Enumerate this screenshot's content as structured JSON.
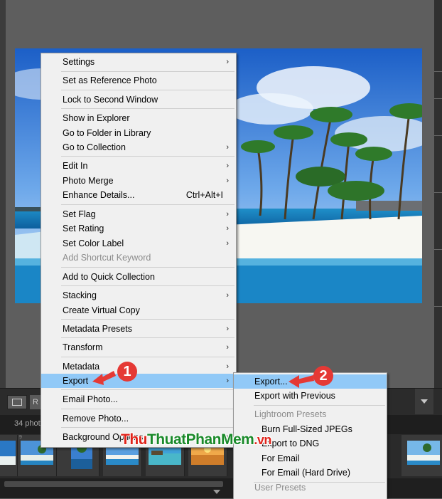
{
  "colors": {
    "menu_bg": "#f0f0f0",
    "highlight": "#91c9f7",
    "callout": "#e53935",
    "disabled_text": "#8c8c8c",
    "app_bg": "#5e5e5e"
  },
  "context_menu": {
    "items": [
      {
        "label": "Settings",
        "arrow": "›"
      },
      {
        "label": "Set as Reference Photo"
      },
      {
        "label": "Lock to Second Window"
      },
      {
        "label": "Show in Explorer"
      },
      {
        "label": "Go to Folder in Library"
      },
      {
        "label": "Go to Collection",
        "arrow": "›"
      },
      {
        "label": "Edit In",
        "arrow": "›"
      },
      {
        "label": "Photo Merge",
        "arrow": "›"
      },
      {
        "label": "Enhance Details...",
        "shortcut": "Ctrl+Alt+I"
      },
      {
        "label": "Set Flag",
        "arrow": "›"
      },
      {
        "label": "Set Rating",
        "arrow": "›"
      },
      {
        "label": "Set Color Label",
        "arrow": "›"
      },
      {
        "label": "Add Shortcut Keyword",
        "disabled": true
      },
      {
        "label": "Add to Quick Collection"
      },
      {
        "label": "Stacking",
        "arrow": "›"
      },
      {
        "label": "Create Virtual Copy"
      },
      {
        "label": "Metadata Presets",
        "arrow": "›"
      },
      {
        "label": "Transform",
        "arrow": "›"
      },
      {
        "label": "Metadata",
        "arrow": "›"
      },
      {
        "label": "Export",
        "arrow": "›",
        "highlighted": true
      },
      {
        "label": "Email Photo..."
      },
      {
        "label": "Remove Photo..."
      },
      {
        "label": "Background Options",
        "arrow": "›"
      }
    ]
  },
  "export_submenu": {
    "items": [
      {
        "label": "Export...",
        "highlighted": true
      },
      {
        "label": "Export with Previous"
      },
      {
        "label": "Lightroom Presets",
        "disabled": true
      },
      {
        "label": "Burn Full-Sized JPEGs"
      },
      {
        "label": "Export to DNG"
      },
      {
        "label": "For Email"
      },
      {
        "label": "For Email (Hard Drive)"
      },
      {
        "label": "User Presets",
        "disabled": true
      }
    ]
  },
  "callouts": {
    "step1": "1",
    "step2": "2"
  },
  "status": {
    "photo_count": "34 photos"
  },
  "toolbar": {
    "button2_label": "R"
  },
  "watermark": {
    "part1": "Thu",
    "part2": "Thuat",
    "part3": "PhanMem",
    "part4": ".vn"
  }
}
